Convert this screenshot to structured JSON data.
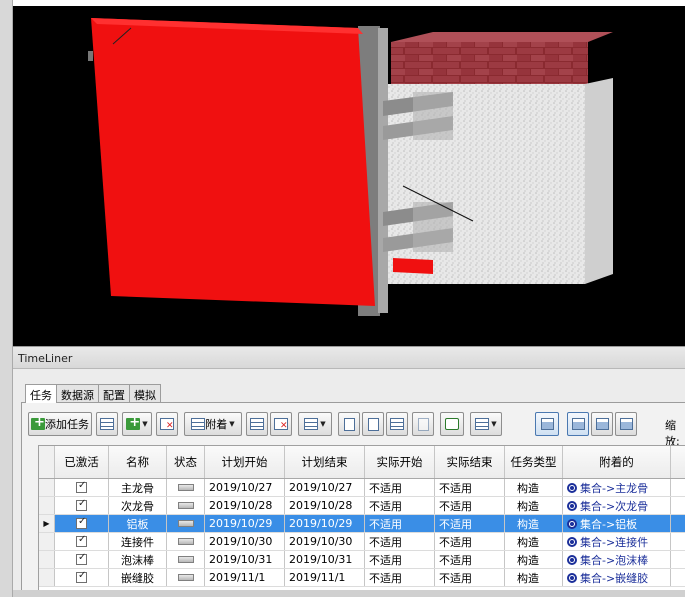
{
  "panel": {
    "title": "TimeLiner"
  },
  "tabs": [
    {
      "label": "任务",
      "active": true
    },
    {
      "label": "数据源",
      "active": false
    },
    {
      "label": "配置",
      "active": false
    },
    {
      "label": "模拟",
      "active": false
    }
  ],
  "toolbar": {
    "add_task": "添加任务",
    "attach": "附着",
    "zoom_label": "缩放:"
  },
  "grid": {
    "headers": [
      "已激活",
      "名称",
      "状态",
      "计划开始",
      "计划结束",
      "实际开始",
      "实际结束",
      "任务类型",
      "附着的",
      "总"
    ],
    "rows": [
      {
        "active": true,
        "name": "主龙骨",
        "plan_start": "2019/10/27",
        "plan_end": "2019/10/27",
        "actual_start": "不适用",
        "actual_end": "不适用",
        "type": "构造",
        "attached": "集合->主龙骨",
        "selected": false
      },
      {
        "active": true,
        "name": "次龙骨",
        "plan_start": "2019/10/28",
        "plan_end": "2019/10/28",
        "actual_start": "不适用",
        "actual_end": "不适用",
        "type": "构造",
        "attached": "集合->次龙骨",
        "selected": false
      },
      {
        "active": true,
        "name": "铝板",
        "plan_start": "2019/10/29",
        "plan_end": "2019/10/29",
        "actual_start": "不适用",
        "actual_end": "不适用",
        "type": "构造",
        "attached": "集合->铝板",
        "selected": true
      },
      {
        "active": true,
        "name": "连接件",
        "plan_start": "2019/10/30",
        "plan_end": "2019/10/30",
        "actual_start": "不适用",
        "actual_end": "不适用",
        "type": "构造",
        "attached": "集合->连接件",
        "selected": false
      },
      {
        "active": true,
        "name": "泡沫棒",
        "plan_start": "2019/10/31",
        "plan_end": "2019/10/31",
        "actual_start": "不适用",
        "actual_end": "不适用",
        "type": "构造",
        "attached": "集合->泡沫棒",
        "selected": false
      },
      {
        "active": true,
        "name": "嵌缝胶",
        "plan_start": "2019/11/1",
        "plan_end": "2019/11/1",
        "actual_start": "不适用",
        "actual_end": "不适用",
        "type": "构造",
        "attached": "集合->嵌缝胶",
        "selected": false
      }
    ]
  },
  "colors": {
    "selection": "#3a8ee6",
    "panel_red": "#f01010",
    "attach_blue": "#1b2f9a"
  }
}
